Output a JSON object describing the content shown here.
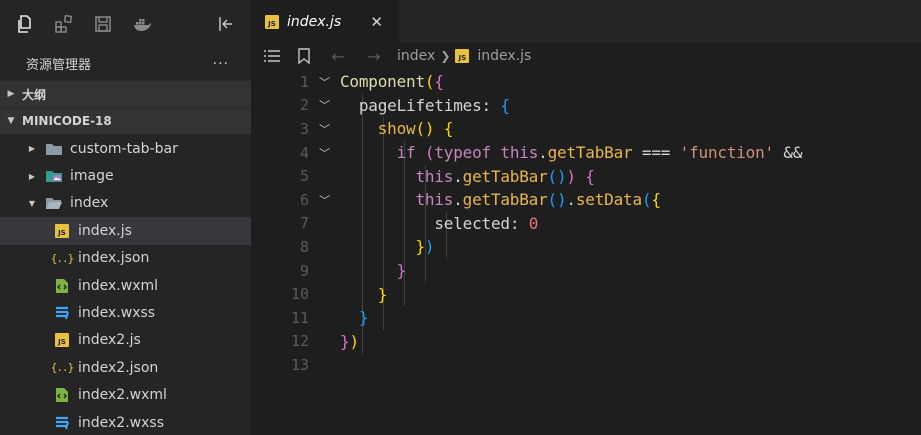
{
  "activity_bar": {
    "icons": [
      "explorer-icon",
      "extensions-icon",
      "save-icon",
      "docker-icon",
      "collapse-panel-icon"
    ]
  },
  "explorer": {
    "title": "资源管理器",
    "more": "···",
    "outline_section": "大纲",
    "project_section": "MINICODE-18",
    "tree": [
      {
        "label": "custom-tab-bar",
        "type": "folder",
        "expanded": false
      },
      {
        "label": "image",
        "type": "folder-image",
        "expanded": false
      },
      {
        "label": "index",
        "type": "folder",
        "expanded": true
      },
      {
        "label": "index.js",
        "type": "js",
        "selected": true
      },
      {
        "label": "index.json",
        "type": "json"
      },
      {
        "label": "index.wxml",
        "type": "wxml"
      },
      {
        "label": "index.wxss",
        "type": "wxss"
      },
      {
        "label": "index2.js",
        "type": "js"
      },
      {
        "label": "index2.json",
        "type": "json"
      },
      {
        "label": "index2.wxml",
        "type": "wxml"
      },
      {
        "label": "index2.wxss",
        "type": "wxss"
      }
    ]
  },
  "tab": {
    "badge": "JS",
    "label": "index.js",
    "close": "✕"
  },
  "breadcrumbs": {
    "folder": "index",
    "file": "index.js"
  },
  "code": {
    "line_numbers": [
      "1",
      "2",
      "3",
      "4",
      "5",
      "6",
      "7",
      "8",
      "9",
      "10",
      "11",
      "12",
      "13"
    ],
    "l1": {
      "fn": "Component",
      "p": "(",
      "b": "{"
    },
    "l2": {
      "prop": "pageLifetimes",
      "colon": ": ",
      "b": "{"
    },
    "l3": {
      "fn": "show",
      "p": "()",
      "sp": " ",
      "b": "{"
    },
    "l4": {
      "kw": "if",
      "sp": " ",
      "p": "(",
      "typeof": "typeof",
      "this": "this",
      "dot": ".",
      "fn": "getTabBar",
      "eq": " === ",
      "str": "'function'",
      "and": " &&"
    },
    "l5": {
      "this": "this",
      "dot": ".",
      "fn": "getTabBar",
      "pp": "()",
      "close": ")",
      "sp": " ",
      "b": "{"
    },
    "l6": {
      "this": "this",
      "dot": ".",
      "fn": "getTabBar",
      "pp": "()",
      "dot2": ".",
      "fn2": "setData",
      "p": "(",
      "b": "{"
    },
    "l7": {
      "prop": "selected",
      "colon": ": ",
      "num": "0"
    },
    "l8": {
      "b": "}",
      "p": ")"
    },
    "l9": {
      "b": "}"
    },
    "l10": {
      "b": "}"
    },
    "l11": {
      "b": "}"
    },
    "l12": {
      "b": "}",
      "p": ")"
    }
  }
}
